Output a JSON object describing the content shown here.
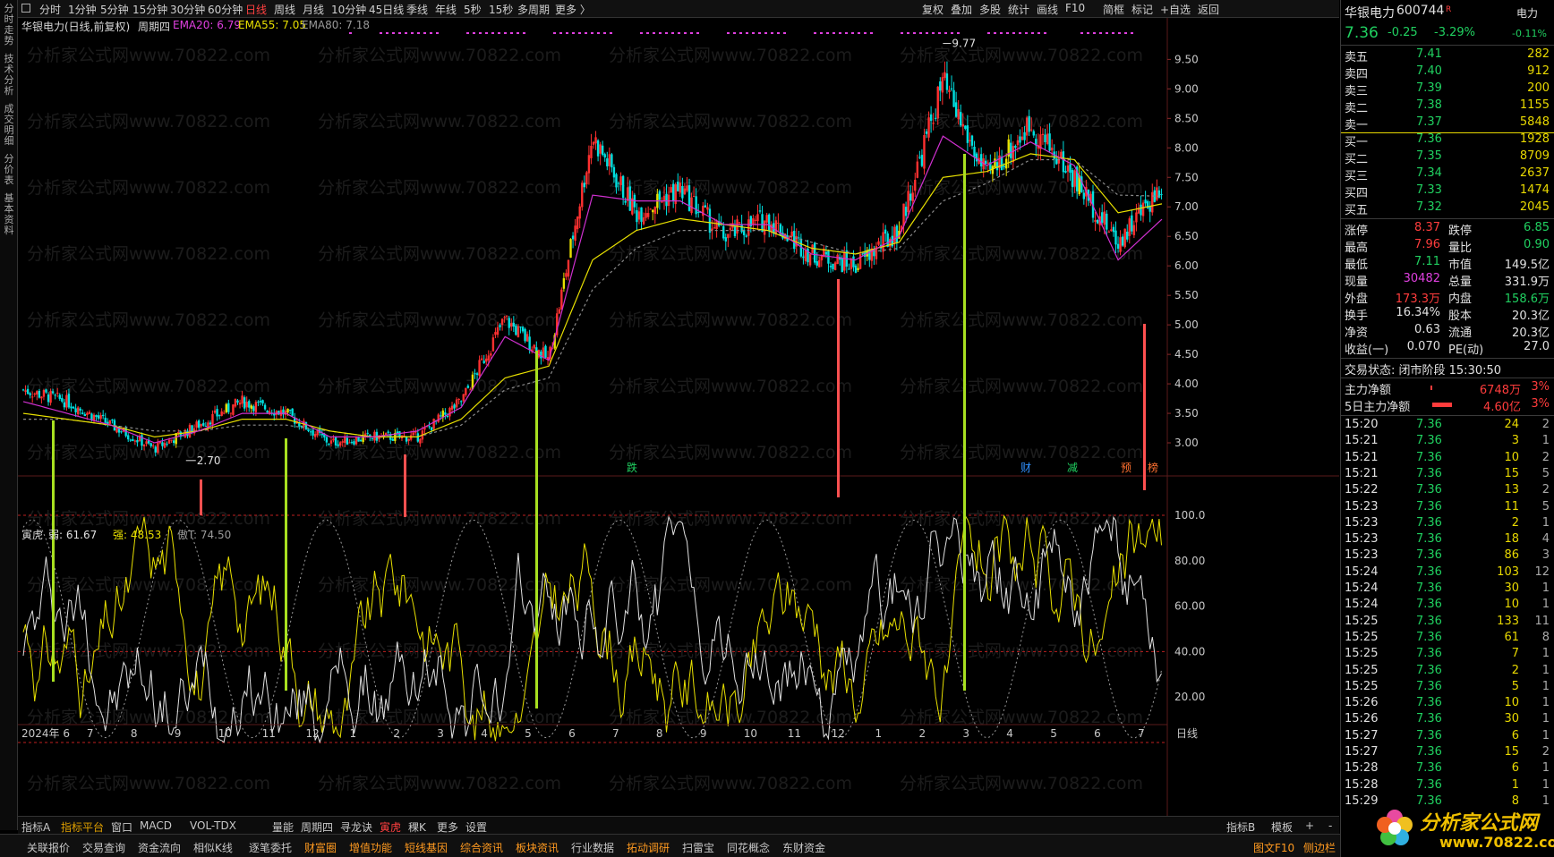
{
  "left_tabs": [
    "分时走势",
    "技术分析",
    "成交明细",
    "分价表",
    "基本资料"
  ],
  "period_tabs": [
    "分时",
    "1分钟",
    "5分钟",
    "15分钟",
    "30分钟",
    "60分钟",
    "日线",
    "周线",
    "月线",
    "10分钟",
    "45日线",
    "季线",
    "年线",
    "5秒",
    "15秒",
    "多周期",
    "更多 〉"
  ],
  "active_period": "日线",
  "right_tools": [
    "复权",
    "叠加",
    "多股",
    "统计",
    "画线",
    "F10",
    "简框",
    "标记",
    "+自选",
    "返回"
  ],
  "legend": {
    "stock": "华银电力(日线,前复权)",
    "cycle": "周期四",
    "ema20": "EMA20: 6.79",
    "ema55": "EMA55: 7.05",
    "ema80": "EMA80: 7.18"
  },
  "sub_legend": {
    "name": "寅虎",
    "weak": "弱: 61.67",
    "strong": "强: 48.53",
    "t": "傲T: 74.50"
  },
  "price_axis": [
    "9.50",
    "9.00",
    "8.50",
    "8.00",
    "7.50",
    "7.00",
    "6.50",
    "6.00",
    "5.50",
    "5.00",
    "4.50",
    "4.00",
    "3.50",
    "3.00"
  ],
  "ind_axis": [
    "100.0",
    "80.00",
    "60.00",
    "40.00",
    "20.00"
  ],
  "date_axis": [
    "2024年 6",
    "7",
    "8",
    "9",
    "10",
    "11",
    "12",
    "1",
    "2",
    "3",
    "4",
    "5",
    "6",
    "7",
    "8",
    "9",
    "10",
    "11",
    "12",
    "1",
    "2",
    "3",
    "4",
    "5",
    "6",
    "7"
  ],
  "date_axis_right": "日线",
  "annotations": {
    "high": "9.77",
    "low": "2.70",
    "events": [
      "跌",
      "财",
      "减",
      "预",
      "榜"
    ]
  },
  "quote": {
    "name": "华银电力",
    "code": "600744",
    "badge": "R",
    "sector": "电力",
    "sector_change": "-0.11%",
    "price": "7.36",
    "change": "-0.25",
    "change_pct": "-3.29%"
  },
  "order_book": [
    {
      "label": "卖五",
      "price": "7.41",
      "vol": "282"
    },
    {
      "label": "卖四",
      "price": "7.40",
      "vol": "912"
    },
    {
      "label": "卖三",
      "price": "7.39",
      "vol": "200"
    },
    {
      "label": "卖二",
      "price": "7.38",
      "vol": "1155"
    },
    {
      "label": "卖一",
      "price": "7.37",
      "vol": "5848"
    },
    {
      "label": "买一",
      "price": "7.36",
      "vol": "1928"
    },
    {
      "label": "买二",
      "price": "7.35",
      "vol": "8709"
    },
    {
      "label": "买三",
      "price": "7.34",
      "vol": "2637"
    },
    {
      "label": "买四",
      "price": "7.33",
      "vol": "1474"
    },
    {
      "label": "买五",
      "price": "7.32",
      "vol": "2045"
    }
  ],
  "stats": [
    {
      "l1": "涨停",
      "v1": "8.37",
      "c1": "red",
      "l2": "跌停",
      "v2": "6.85",
      "c2": "green"
    },
    {
      "l1": "最高",
      "v1": "7.96",
      "c1": "red",
      "l2": "量比",
      "v2": "0.90",
      "c2": "green"
    },
    {
      "l1": "最低",
      "v1": "7.11",
      "c1": "green",
      "l2": "市值",
      "v2": "149.5亿",
      "c2": "white"
    },
    {
      "l1": "现量",
      "v1": "30482",
      "c1": "mag",
      "l2": "总量",
      "v2": "331.9万",
      "c2": "white"
    },
    {
      "l1": "外盘",
      "v1": "173.3万",
      "c1": "red",
      "l2": "内盘",
      "v2": "158.6万",
      "c2": "green"
    },
    {
      "l1": "换手",
      "v1": "16.34%",
      "c1": "white",
      "l2": "股本",
      "v2": "20.3亿",
      "c2": "white"
    },
    {
      "l1": "净资",
      "v1": "0.63",
      "c1": "white",
      "l2": "流通",
      "v2": "20.3亿",
      "c2": "white"
    },
    {
      "l1": "收益(一)",
      "v1": "0.070",
      "c1": "white",
      "l2": "PE(动)",
      "v2": "27.0",
      "c2": "white"
    }
  ],
  "trade_status": "交易状态: 闭市阶段 15:30:50",
  "flow": [
    {
      "label": "主力净额",
      "value": "6748万",
      "pct": "3%"
    },
    {
      "label": "5日主力净额",
      "value": "4.60亿",
      "pct": "3%"
    }
  ],
  "ticks": [
    {
      "t": "15:20",
      "p": "7.36",
      "v": "24",
      "n": "2"
    },
    {
      "t": "15:21",
      "p": "7.36",
      "v": "3",
      "n": "1"
    },
    {
      "t": "15:21",
      "p": "7.36",
      "v": "10",
      "n": "2"
    },
    {
      "t": "15:21",
      "p": "7.36",
      "v": "15",
      "n": "5"
    },
    {
      "t": "15:22",
      "p": "7.36",
      "v": "13",
      "n": "2"
    },
    {
      "t": "15:23",
      "p": "7.36",
      "v": "11",
      "n": "5"
    },
    {
      "t": "15:23",
      "p": "7.36",
      "v": "2",
      "n": "1"
    },
    {
      "t": "15:23",
      "p": "7.36",
      "v": "18",
      "n": "4"
    },
    {
      "t": "15:23",
      "p": "7.36",
      "v": "86",
      "n": "3"
    },
    {
      "t": "15:24",
      "p": "7.36",
      "v": "103",
      "n": "12"
    },
    {
      "t": "15:24",
      "p": "7.36",
      "v": "30",
      "n": "1"
    },
    {
      "t": "15:24",
      "p": "7.36",
      "v": "10",
      "n": "1"
    },
    {
      "t": "15:25",
      "p": "7.36",
      "v": "133",
      "n": "11"
    },
    {
      "t": "15:25",
      "p": "7.36",
      "v": "61",
      "n": "8"
    },
    {
      "t": "15:25",
      "p": "7.36",
      "v": "7",
      "n": "1"
    },
    {
      "t": "15:25",
      "p": "7.36",
      "v": "2",
      "n": "1"
    },
    {
      "t": "15:25",
      "p": "7.36",
      "v": "5",
      "n": "1"
    },
    {
      "t": "15:26",
      "p": "7.36",
      "v": "10",
      "n": "1"
    },
    {
      "t": "15:26",
      "p": "7.36",
      "v": "30",
      "n": "1"
    },
    {
      "t": "15:27",
      "p": "7.36",
      "v": "6",
      "n": "1"
    },
    {
      "t": "15:27",
      "p": "7.36",
      "v": "15",
      "n": "2"
    },
    {
      "t": "15:28",
      "p": "7.36",
      "v": "6",
      "n": "1"
    },
    {
      "t": "15:28",
      "p": "7.36",
      "v": "1",
      "n": "1"
    },
    {
      "t": "15:29",
      "p": "7.36",
      "v": "8",
      "n": "1"
    }
  ],
  "ind_tabs": [
    "指标A",
    "指标平台",
    "窗口",
    "MACD",
    "VOL-TDX",
    "量能",
    "周期四",
    "寻龙诀",
    "寅虎",
    "稞K",
    "更多",
    "设置"
  ],
  "ind_tabs_right": [
    "指标B",
    "模板",
    "+",
    "-"
  ],
  "func_tabs": [
    "关联报价",
    "交易查询",
    "资金流向",
    "相似K线",
    "逐笔委托",
    "财富圈",
    "增值功能",
    "短线基因",
    "综合资讯",
    "板块资讯",
    "行业数据",
    "拓动调研",
    "扫雷宝",
    "同花概念",
    "东财资金"
  ],
  "func_tabs_right": [
    "图文F10",
    "侧边栏"
  ],
  "watermark": "分析家公式网www.70822.com",
  "logo_text": "分析家公式网",
  "logo_url": "www.70822.com",
  "colors": {
    "up": "#ff3c3c",
    "down": "#20d060",
    "ema20": "#d030d0",
    "ema55": "#e8e000",
    "candle_up": "#ff3030",
    "candle_down": "#00e0e0"
  },
  "chart_data": {
    "type": "candlestick",
    "title": "华银电力(日线,前复权)",
    "ylim": [
      2.5,
      9.9
    ],
    "x": [
      "2024-06",
      "2024-07",
      "2024-08",
      "2024-09",
      "2024-10",
      "2024-11",
      "2024-12",
      "2025-01",
      "2025-02",
      "2025-03",
      "2025-04",
      "2025-05",
      "2025-06",
      "2025-07",
      "2025-08",
      "2025-09",
      "2025-10",
      "2025-11",
      "2025-12",
      "2026-01",
      "2026-02",
      "2026-03",
      "2026-04",
      "2026-05",
      "2026-06",
      "2026-07"
    ],
    "close_path": [
      3.9,
      3.7,
      3.3,
      2.9,
      3.3,
      3.7,
      3.5,
      3.0,
      3.1,
      3.1,
      3.7,
      5.1,
      4.4,
      8.2,
      6.9,
      7.3,
      6.5,
      6.8,
      6.2,
      6.0,
      6.6,
      9.1,
      7.5,
      8.4,
      7.5,
      6.4,
      7.36
    ],
    "ema20": [
      3.7,
      3.5,
      3.3,
      3.0,
      3.2,
      3.5,
      3.5,
      3.1,
      3.1,
      3.2,
      3.6,
      4.8,
      4.4,
      7.2,
      7.1,
      7.1,
      6.7,
      6.7,
      6.2,
      6.1,
      6.5,
      8.2,
      7.7,
      8.1,
      7.7,
      6.1,
      6.79
    ],
    "ema55": [
      3.5,
      3.4,
      3.3,
      3.1,
      3.2,
      3.4,
      3.4,
      3.2,
      3.1,
      3.1,
      3.4,
      4.1,
      4.3,
      6.1,
      6.6,
      6.8,
      6.7,
      6.6,
      6.3,
      6.2,
      6.4,
      7.5,
      7.6,
      7.9,
      7.8,
      6.9,
      7.05
    ],
    "ema80": [
      3.4,
      3.4,
      3.3,
      3.2,
      3.2,
      3.3,
      3.3,
      3.2,
      3.1,
      3.1,
      3.3,
      3.9,
      4.1,
      5.6,
      6.3,
      6.6,
      6.6,
      6.6,
      6.4,
      6.2,
      6.3,
      7.1,
      7.4,
      7.8,
      7.8,
      7.2,
      7.18
    ],
    "high": 9.77,
    "low": 2.7
  }
}
